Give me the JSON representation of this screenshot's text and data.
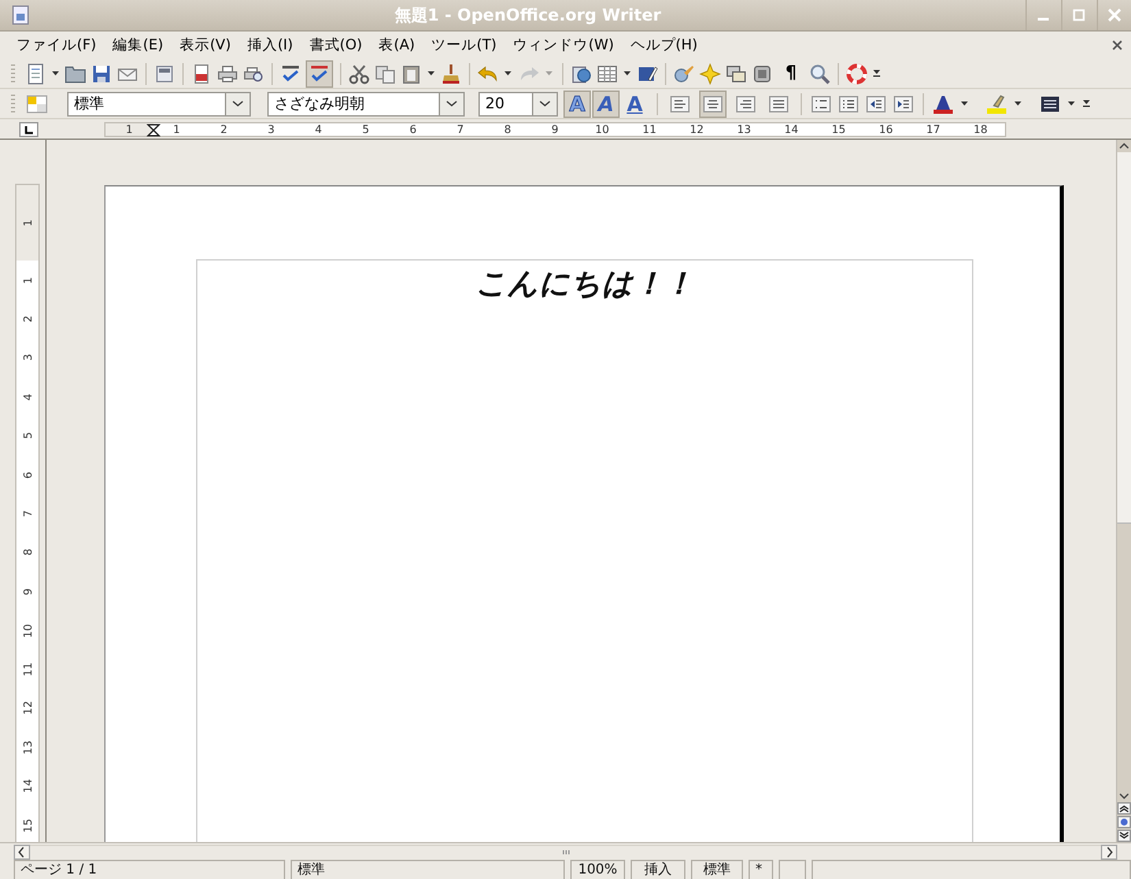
{
  "window": {
    "title": "無題1 - OpenOffice.org Writer"
  },
  "menu": [
    {
      "label": "ファイル(F)"
    },
    {
      "label": "編集(E)"
    },
    {
      "label": "表示(V)"
    },
    {
      "label": "挿入(I)"
    },
    {
      "label": "書式(O)"
    },
    {
      "label": "表(A)"
    },
    {
      "label": "ツール(T)"
    },
    {
      "label": "ウィンドウ(W)"
    },
    {
      "label": "ヘルプ(H)"
    }
  ],
  "standard_toolbar": {
    "auto_spellcheck": {
      "on": true
    },
    "redo": {
      "disabled": true
    },
    "formatting_marks": {
      "glyph": "¶",
      "on": false
    }
  },
  "formatting_toolbar": {
    "paragraph_style": "標準",
    "font_name": "さざなみ明朝",
    "font_size": "20",
    "bold": {
      "glyph": "A",
      "on": true
    },
    "italic": {
      "glyph": "A",
      "on": true
    },
    "underline": {
      "glyph": "A",
      "on": false
    },
    "alignment": [
      {
        "selected": false
      },
      {
        "selected": true
      },
      {
        "selected": false
      },
      {
        "selected": false
      }
    ]
  },
  "horizontal_ruler": {
    "labels": [
      "1",
      "1",
      "2",
      "3",
      "4",
      "5",
      "6",
      "7",
      "8",
      "9",
      "10",
      "11",
      "12",
      "13",
      "14",
      "15",
      "16",
      "17",
      "18"
    ]
  },
  "vertical_ruler": {
    "labels": [
      "1",
      "1",
      "2",
      "3",
      "4",
      "5",
      "6",
      "7",
      "8",
      "9",
      "10",
      "11",
      "12",
      "13",
      "14",
      "15"
    ]
  },
  "document": {
    "paragraphs": [
      "こんにちは！！"
    ]
  },
  "status_bar": {
    "page": "ページ 1 / 1",
    "page_style": "標準",
    "zoom": "100%",
    "insert_mode": "挿入",
    "selection_mode": "標準",
    "modified": "*"
  }
}
